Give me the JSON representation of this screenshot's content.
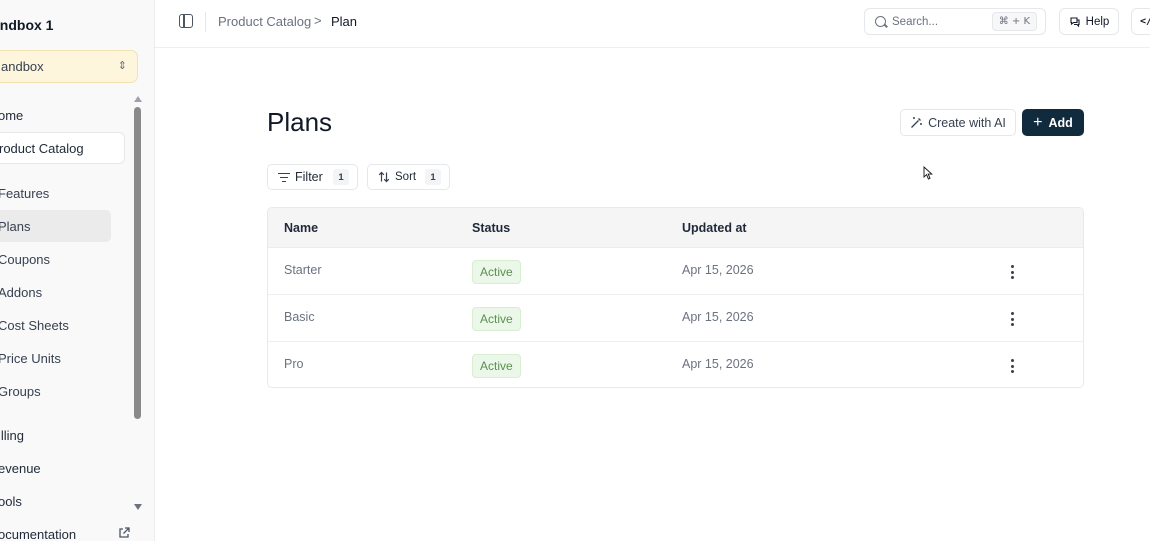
{
  "sidebar": {
    "workspace_title": "andbox 1",
    "environment": {
      "value": "andbox",
      "icon": "chevron-up-down-icon"
    },
    "items": [
      {
        "label": "ome"
      },
      {
        "label": "roduct Catalog"
      },
      {
        "label": "Features"
      },
      {
        "label": "Plans"
      },
      {
        "label": "Coupons"
      },
      {
        "label": "Addons"
      },
      {
        "label": "Cost Sheets"
      },
      {
        "label": "Price Units"
      },
      {
        "label": "Groups"
      },
      {
        "label": "illing"
      },
      {
        "label": "evenue"
      },
      {
        "label": "ools"
      },
      {
        "label": "ocumentation",
        "icon": "external-link-icon"
      }
    ]
  },
  "topbar": {
    "breadcrumb": [
      "Product Catalog",
      "Plan"
    ],
    "breadcrumb_separator": ">",
    "search": {
      "placeholder": "Search...",
      "shortcut": "⌘ + K"
    },
    "help_label": "Help",
    "code_label": "</"
  },
  "main": {
    "title": "Plans",
    "create_ai_label": "Create with AI",
    "add_label": "Add",
    "filter": {
      "label": "Filter",
      "count": "1"
    },
    "sort": {
      "label": "Sort",
      "count": "1"
    },
    "table": {
      "columns": [
        "Name",
        "Status",
        "Updated at"
      ],
      "rows": [
        {
          "name": "Starter",
          "status": "Active",
          "updated": "Apr 15, 2026"
        },
        {
          "name": "Basic",
          "status": "Active",
          "updated": "Apr 15, 2026"
        },
        {
          "name": "Pro",
          "status": "Active",
          "updated": "Apr 15, 2026"
        }
      ]
    }
  },
  "colors": {
    "accent": "#0f2b3d",
    "environment_bg": "#fdf6dd",
    "status_active_bg": "#ebf7e8",
    "status_active_text": "#5b8f4f"
  }
}
